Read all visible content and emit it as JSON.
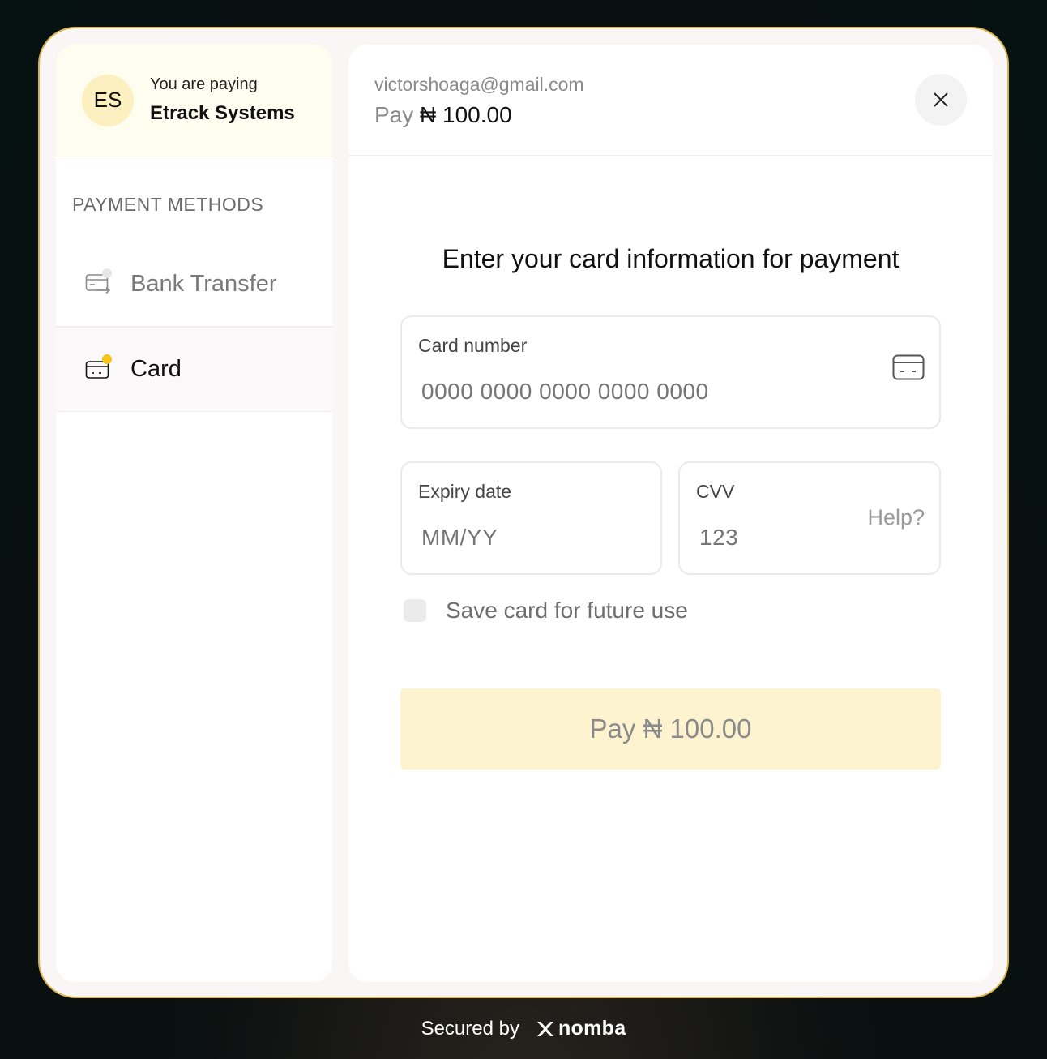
{
  "merchant": {
    "initials": "ES",
    "paying_label": "You are paying",
    "name": "Etrack Systems"
  },
  "sidebar": {
    "heading": "PAYMENT METHODS",
    "methods": [
      {
        "label": "Bank Transfer",
        "icon": "bank-transfer-icon",
        "active": false
      },
      {
        "label": "Card",
        "icon": "card-icon",
        "active": true
      }
    ]
  },
  "header": {
    "email": "victorshoaga@gmail.com",
    "pay_word": "Pay",
    "amount": "₦ 100.00"
  },
  "form": {
    "title": "Enter your card information for payment",
    "card_number": {
      "label": "Card number",
      "placeholder": "0000 0000 0000 0000 0000"
    },
    "expiry": {
      "label": "Expiry date",
      "placeholder": "MM/YY"
    },
    "cvv": {
      "label": "CVV",
      "placeholder": "123",
      "help": "Help?"
    },
    "save_card_label": "Save card for future use",
    "pay_button": "Pay ₦ 100.00"
  },
  "footer": {
    "secured_by": "Secured by",
    "brand": "nomba"
  },
  "colors": {
    "accent": "#fdf3cf",
    "border": "#d9b24a",
    "indicator": "#f5c518"
  }
}
